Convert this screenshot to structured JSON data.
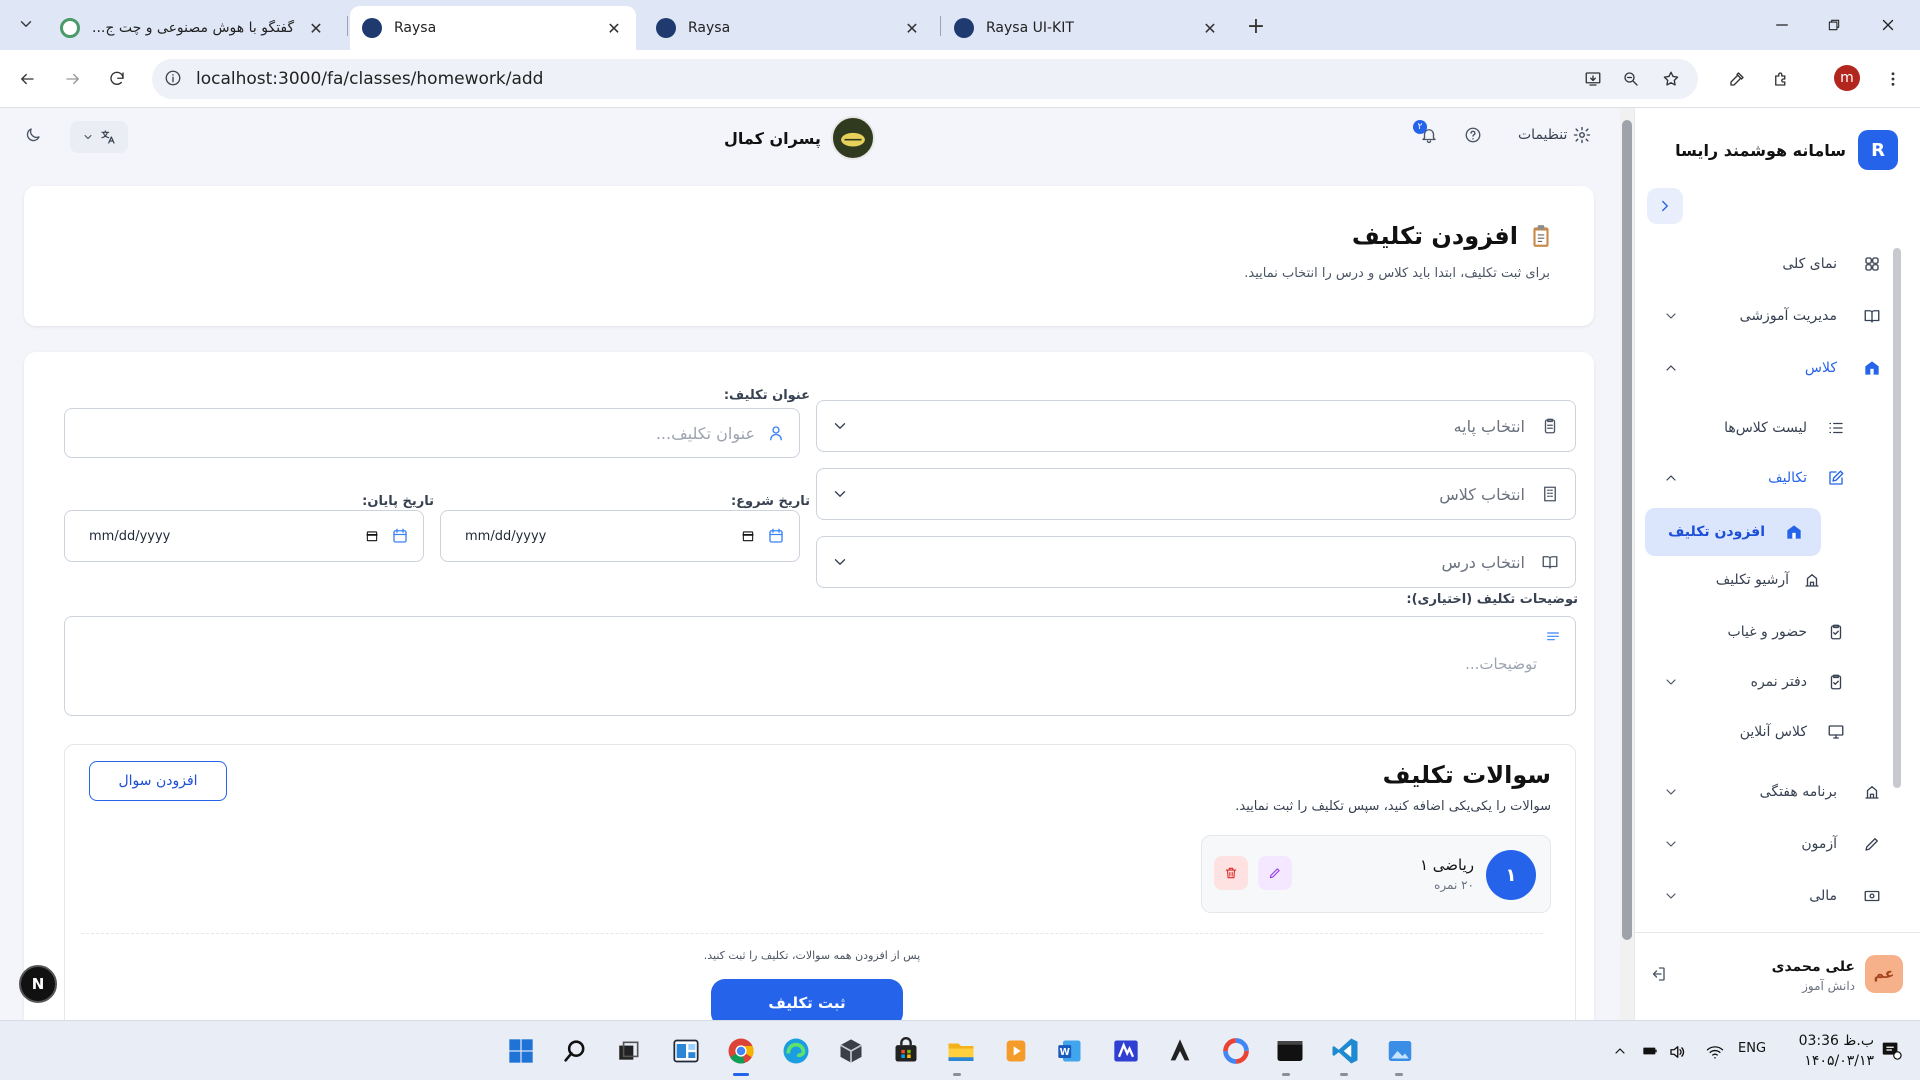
{
  "browser": {
    "tabs": [
      {
        "title": "گفتگو با هوش مصنوعی و چت ج...",
        "active": false
      },
      {
        "title": "Raysa",
        "active": true
      },
      {
        "title": "Raysa",
        "active": false
      },
      {
        "title": "Raysa UI-KIT",
        "active": false
      }
    ],
    "url": "localhost:3000/fa/classes/homework/add",
    "profile_initial": "m"
  },
  "sidebar": {
    "brand_initial": "R",
    "brand_name": "سامانه هوشمند رایسا",
    "items": [
      {
        "label": "نمای کلی",
        "icon": "grid-icon"
      },
      {
        "label": "مدیریت آموزشی",
        "icon": "book-icon"
      },
      {
        "label": "کلاس",
        "icon": "school-icon"
      },
      {
        "label": "لیست کلاس‌ها",
        "icon": "list-icon"
      },
      {
        "label": "تکالیف",
        "icon": "edit-icon"
      },
      {
        "label": "افزودن تکلیف",
        "icon": "school-icon"
      },
      {
        "label": "آرشیو تکلیف",
        "icon": "building-icon"
      },
      {
        "label": "حضور و غیاب",
        "icon": "clipboard-check-icon"
      },
      {
        "label": "دفتر نمره",
        "icon": "clipboard-check-icon"
      },
      {
        "label": "کلاس آنلاین",
        "icon": "monitor-icon"
      },
      {
        "label": "برنامه هفتگی",
        "icon": "building-icon"
      },
      {
        "label": "آزمون",
        "icon": "pencil-icon"
      },
      {
        "label": "مالی",
        "icon": "money-icon"
      }
    ],
    "user": {
      "initials": "عم",
      "name": "علی محمدی",
      "role": "دانش آموز"
    }
  },
  "topbar": {
    "school_name": "پسران کمال",
    "settings_label": "تنظیمات",
    "notification_count": "۲"
  },
  "page": {
    "title": "افزودن تکلیف",
    "subtitle": "برای ثبت تکلیف، ابتدا باید کلاس و درس را انتخاب نمایید."
  },
  "form": {
    "grade_placeholder": "انتخاب پایه",
    "class_placeholder": "انتخاب کلاس",
    "lesson_placeholder": "انتخاب درس",
    "title_label": "عنوان تکلیف:",
    "title_placeholder": "عنوان تکلیف...",
    "start_label": "تاریخ شروع:",
    "end_label": "تاریخ پایان:",
    "date_placeholder": "mm/dd/yyyy",
    "desc_label": "توضیحات تکلیف (اختیاری):",
    "desc_placeholder": "توضیحات..."
  },
  "questions": {
    "title": "سوالات تکلیف",
    "subtitle": "سوالات را یکی‌یکی اضافه کنید، سپس تکلیف را ثبت نمایید.",
    "add_label": "افزودن سوال",
    "items": [
      {
        "number": "۱",
        "name": "ریاضی ۱",
        "score": "۲۰ نمره"
      }
    ],
    "hint": "پس از افزودن همه سوالات، تکلیف را ثبت کنید.",
    "submit_label": "ثبت تکلیف"
  },
  "fab_label": "N",
  "taskbar": {
    "language": "ENG",
    "time": "ب.ظ 03:36",
    "date": "۱۴۰۵/۰۳/۱۳"
  },
  "colors": {
    "accent": "#2563eb",
    "active_bg": "#dbe6fd",
    "danger": "#dc2626",
    "edit": "#9333ea"
  }
}
